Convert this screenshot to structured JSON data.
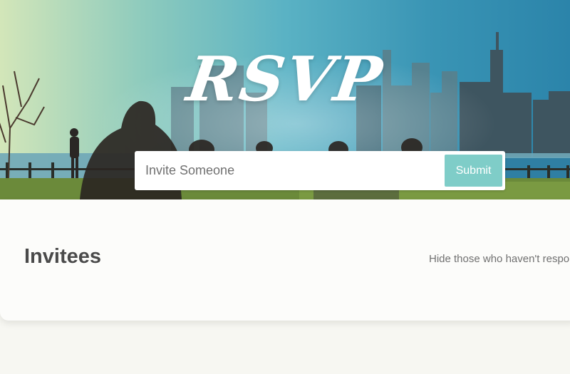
{
  "header": {
    "title": "RSVP",
    "invite_placeholder": "Invite Someone",
    "submit_label": "Submit"
  },
  "main": {
    "section_title": "Invitees",
    "filter_label": "Hide those who haven't responded"
  },
  "colors": {
    "submit_button": "#7fcdc8",
    "page_background": "#f7f7f2",
    "card_background": "#fcfcfa",
    "title_text": "#4a4a4a"
  }
}
